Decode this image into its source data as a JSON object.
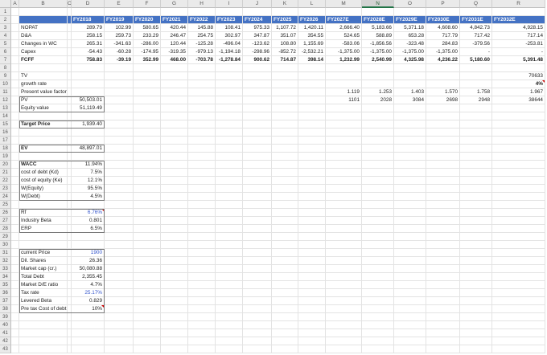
{
  "columns": [
    "A",
    "B",
    "C",
    "D",
    "E",
    "F",
    "G",
    "H",
    "I",
    "J",
    "K",
    "L",
    "M",
    "N",
    "O",
    "P",
    "Q",
    "R"
  ],
  "selected_column": "N",
  "row_numbers": [
    "1",
    "2",
    "3",
    "4",
    "5",
    "6",
    "7",
    "8",
    "9",
    "10",
    "11",
    "12",
    "13",
    "14",
    "15",
    "16",
    "17",
    "18",
    "19",
    "20",
    "21",
    "22",
    "23",
    "24",
    "25",
    "26",
    "27",
    "28",
    "29",
    "30",
    "31",
    "32",
    "33",
    "34",
    "35",
    "36",
    "37",
    "38",
    "39",
    "40",
    "41",
    "42",
    "43"
  ],
  "years": [
    "FY2018",
    "FY2019",
    "FY2020",
    "FY2021",
    "FY2022",
    "FY2023",
    "FY2024",
    "FY2025",
    "FY2026",
    "FY2027E",
    "FY2028E",
    "FY2029E",
    "FY2030E",
    "FY2031E",
    "FY2032E"
  ],
  "table_rows": [
    {
      "label": "NOPAT",
      "values": [
        "289.79",
        "102.99",
        "580.65",
        "420.44",
        "145.88",
        "108.41",
        "975.33",
        "1,107.72",
        "1,420.11",
        "2,666.40",
        "5,183.66",
        "5,371.18",
        "4,608.60",
        "4,842.73",
        "4,928.15"
      ]
    },
    {
      "label": "D&A",
      "values": [
        "258.15",
        "259.73",
        "233.29",
        "246.47",
        "254.75",
        "302.97",
        "347.87",
        "351.07",
        "354.55",
        "524.65",
        "588.89",
        "653.28",
        "717.79",
        "717.42",
        "717.14"
      ]
    },
    {
      "label": "Changes in WC",
      "values": [
        "265.31",
        "-341.63",
        "-286.00",
        "120.44",
        "-125.28",
        "-496.04",
        "-123.62",
        "108.80",
        "1,155.69",
        "-583.06",
        "-1,856.56",
        "-323.48",
        "284.83",
        "-379.56",
        "-253.81"
      ]
    },
    {
      "label": "Capex",
      "values": [
        "-54.43",
        "-60.28",
        "-174.95",
        "-319.35",
        "-979.13",
        "-1,194.18",
        "-298.96",
        "-852.72",
        "-2,532.21",
        "-1,375.00",
        "-1,375.00",
        "-1,375.00",
        "-1,375.00",
        "-",
        "-"
      ]
    },
    {
      "label": "FCFF",
      "values": [
        "758.83",
        "-39.19",
        "352.99",
        "468.00",
        "-703.78",
        "-1,278.84",
        "900.62",
        "714.87",
        "398.14",
        "1,232.99",
        "2,540.99",
        "4,325.98",
        "4,236.22",
        "5,180.60",
        "5,391.48"
      ]
    }
  ],
  "labels": {
    "tv": "TV",
    "growth_rate": "growth rate",
    "pv_factor": "Present value factor",
    "pv": "PV",
    "equity_value": "Equity value",
    "target_price": "Target Price",
    "ev": "EV",
    "wacc": "WACC",
    "cost_debt": "cost of debt (Kd)",
    "cost_equity": "cost of equity (Ke)",
    "w_equity": "W(Equity)",
    "w_debt": "W(Debt)",
    "rf": "Rf",
    "industry_beta": "Industry Beta",
    "erp": "ERP",
    "current_price": "current Price",
    "dil_shares": "Dil. Shares",
    "market_cap": "Market cap (cr.)",
    "total_debt": "Total Debt",
    "market_de": "Market D/E ratio",
    "tax_rate": "Tax rate",
    "levered_beta": "Levered Beta",
    "pretax_cost_debt": "Pre tax Cost of debt"
  },
  "values": {
    "tv": "70633",
    "growth_rate": "4%",
    "pv": "50,503.01",
    "equity_value": "51,119.49",
    "target_price": "1,939.40",
    "ev": "48,897.01",
    "wacc": "11.94%",
    "cost_debt": "7.5%",
    "cost_equity": "12.1%",
    "w_equity": "95.5%",
    "w_debt": "4.5%",
    "rf": "6.76%",
    "industry_beta": "0.801",
    "erp": "6.5%",
    "current_price": "1900",
    "dil_shares": "26.36",
    "market_cap": "50,080.88",
    "total_debt": "2,355.45",
    "market_de": "4.7%",
    "tax_rate": "25.17%",
    "levered_beta": "0.829",
    "pretax_cost_debt": "10%"
  },
  "pv_factors": [
    "1.119",
    "1.253",
    "1.403",
    "1.570",
    "1.758",
    "1.967"
  ],
  "pv_values": [
    "1101",
    "2028",
    "3084",
    "2698",
    "2948",
    "38644"
  ],
  "colors": {
    "header_fill": "#4472c4",
    "input_text": "#3355cc",
    "selection": "#217346",
    "comment_flag": "#d00000"
  }
}
